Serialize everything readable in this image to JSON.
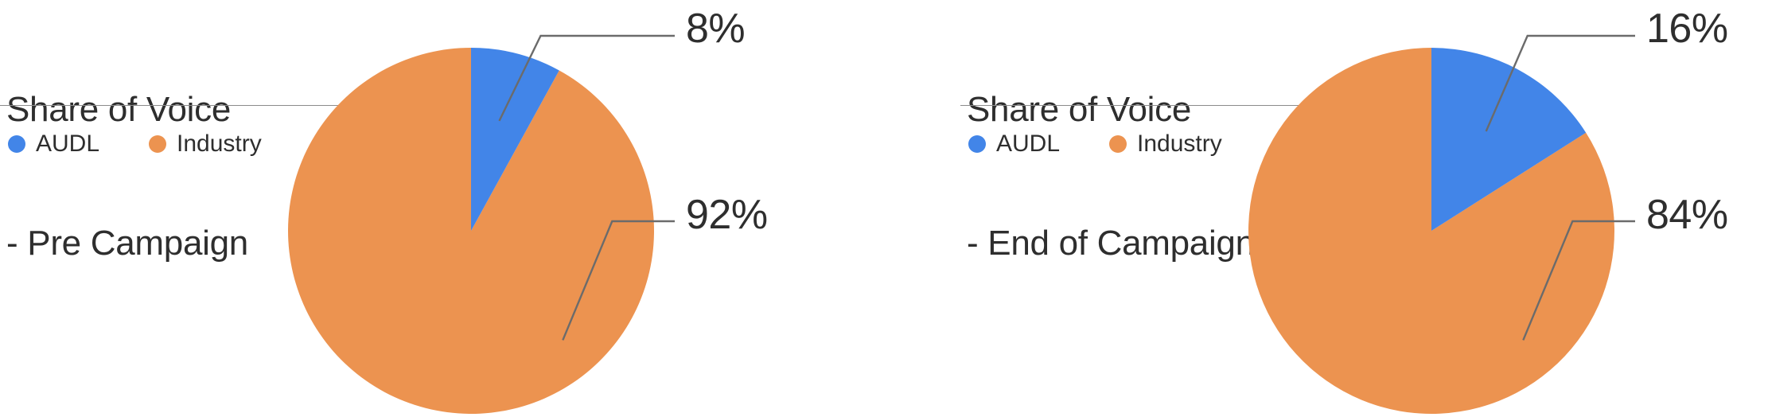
{
  "colors": {
    "audl": "#4285e8",
    "industry": "#ec9350",
    "text": "#2e2e2e",
    "leader_line": "#6b6b6b",
    "divider": "#8c8c8c",
    "background": "#ffffff"
  },
  "panels": [
    {
      "title_line1": "Share of Voice",
      "title_line2": "- Pre Campaign",
      "legend": [
        {
          "label": "AUDL",
          "color": "#4285e8",
          "dot": "legend-dot-blue"
        },
        {
          "label": "Industry",
          "color": "#ec9350",
          "dot": "legend-dot-orange"
        }
      ],
      "labels": {
        "top": "8%",
        "bottom": "92%"
      }
    },
    {
      "title_line1": "Share of Voice",
      "title_line2": "- End of Campaign",
      "legend": [
        {
          "label": "AUDL",
          "color": "#4285e8",
          "dot": "legend-dot-blue"
        },
        {
          "label": "Industry",
          "color": "#ec9350",
          "dot": "legend-dot-orange"
        }
      ],
      "labels": {
        "top": "16%",
        "bottom": "84%"
      }
    }
  ],
  "chart_data": [
    {
      "type": "pie",
      "title": "Share of Voice - Pre Campaign",
      "labels": [
        "AUDL",
        "Industry"
      ],
      "values": [
        8,
        92
      ],
      "value_labels": [
        "8%",
        "92%"
      ],
      "colors": [
        "#4285e8",
        "#ec9350"
      ],
      "units": "percent",
      "start_angle": 90,
      "direction": "clockwise",
      "legend_position": "top-left",
      "grid": false
    },
    {
      "type": "pie",
      "title": "Share of Voice - End of Campaign",
      "labels": [
        "AUDL",
        "Industry"
      ],
      "values": [
        16,
        84
      ],
      "value_labels": [
        "16%",
        "84%"
      ],
      "colors": [
        "#4285e8",
        "#ec9350"
      ],
      "units": "percent",
      "start_angle": 90,
      "direction": "clockwise",
      "legend_position": "top-left",
      "grid": false
    }
  ]
}
